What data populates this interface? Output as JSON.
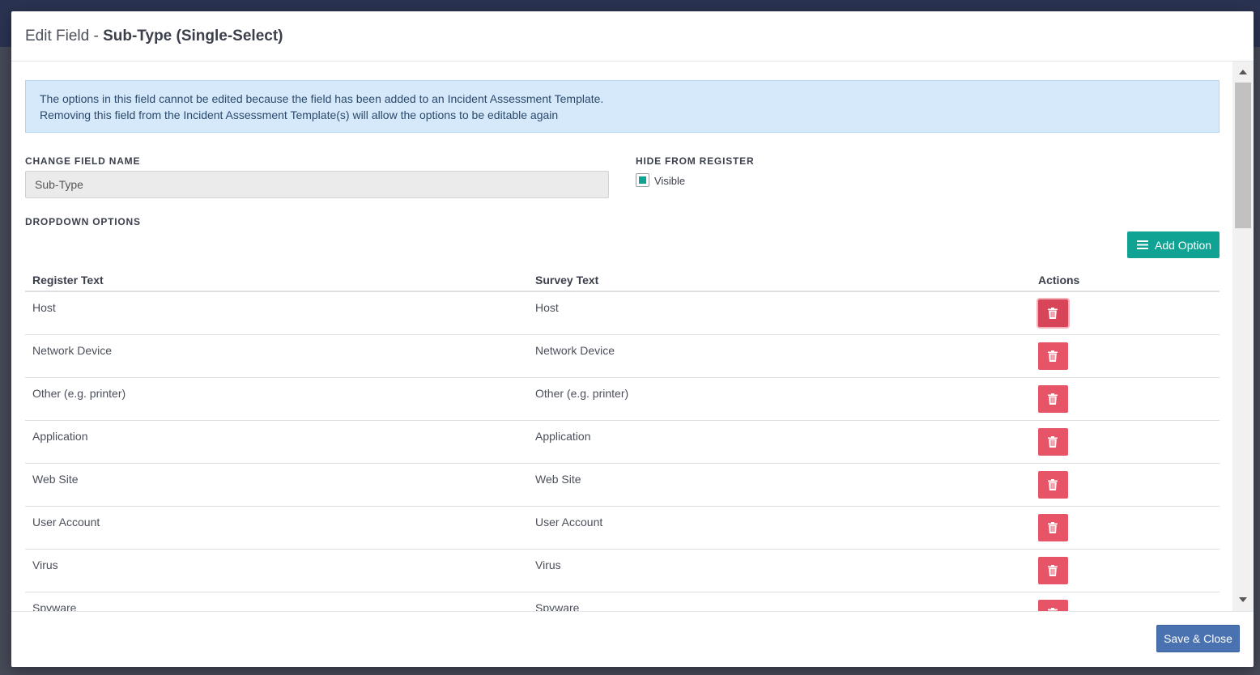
{
  "modal": {
    "title_prefix": "Edit Field - ",
    "title_field": "Sub-Type (Single-Select)"
  },
  "alert": {
    "line1": "The options in this field cannot be edited because the field has been added to an Incident Assessment Template.",
    "line2": "Removing this field from the Incident Assessment Template(s) will allow the options to be editable again"
  },
  "field_name": {
    "label": "CHANGE FIELD NAME",
    "value": "Sub-Type"
  },
  "hide_from_register": {
    "label": "HIDE FROM REGISTER",
    "checkbox_label": "Visible",
    "checked": true
  },
  "dropdown_options": {
    "label": "DROPDOWN OPTIONS",
    "add_button_label": "Add Option",
    "columns": [
      "Register Text",
      "Survey Text",
      "Actions"
    ],
    "rows": [
      {
        "register": "Host",
        "survey": "Host"
      },
      {
        "register": "Network Device",
        "survey": "Network Device"
      },
      {
        "register": "Other (e.g. printer)",
        "survey": "Other (e.g. printer)"
      },
      {
        "register": "Application",
        "survey": "Application"
      },
      {
        "register": "Web Site",
        "survey": "Web Site"
      },
      {
        "register": "User Account",
        "survey": "User Account"
      },
      {
        "register": "Virus",
        "survey": "Virus"
      },
      {
        "register": "Spyware",
        "survey": "Spyware"
      }
    ]
  },
  "footer": {
    "save_label": "Save & Close"
  },
  "colors": {
    "accent_teal": "#10a394",
    "danger": "#e85467",
    "primary_blue": "#4a72b0",
    "alert_bg": "#d5e9fb"
  }
}
